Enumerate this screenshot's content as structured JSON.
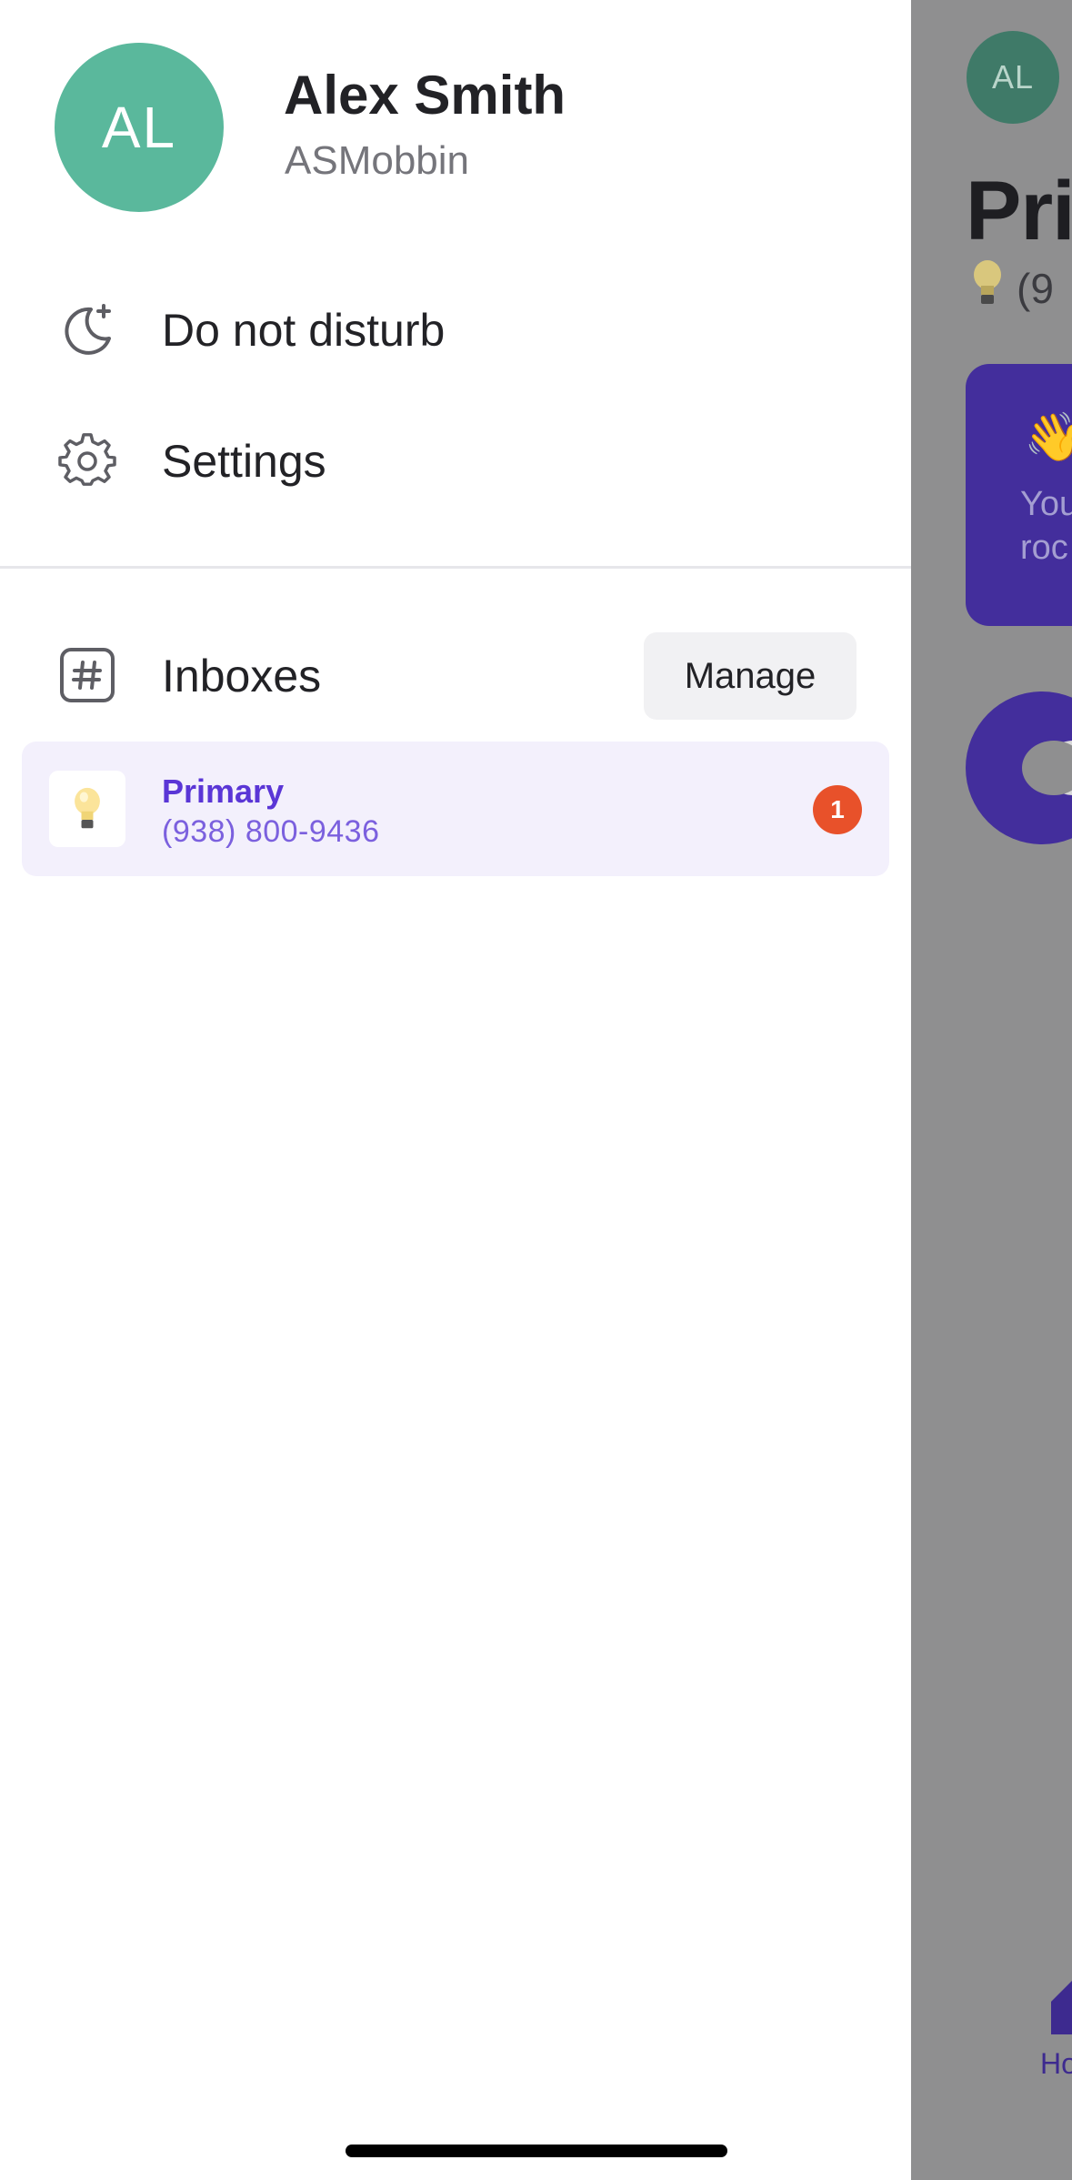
{
  "user": {
    "initials": "AL",
    "name": "Alex Smith",
    "handle": "ASMobbin",
    "avatar_color": "#5ab89c"
  },
  "menu": {
    "do_not_disturb": {
      "label": "Do not disturb",
      "icon": "moon-sparkle-icon"
    },
    "settings": {
      "label": "Settings",
      "icon": "gear-icon"
    }
  },
  "inboxes": {
    "label": "Inboxes",
    "icon": "hash-icon",
    "manage_label": "Manage",
    "items": [
      {
        "emoji": "💡",
        "name": "Primary",
        "phone": "(938) 800-9436",
        "unread": "1",
        "selected": true
      }
    ]
  },
  "background": {
    "avatar_initials": "AL",
    "title": "Pri",
    "subtitle_partial": "(9",
    "card_text": "You\nroc",
    "nav_label": "Ho"
  },
  "colors": {
    "accent": "#5a36d6",
    "badge": "#e8512a",
    "selected_row": "#f3f0fc",
    "overlay": "#8f8f90",
    "brand_purple_dim": "#432e9c"
  }
}
